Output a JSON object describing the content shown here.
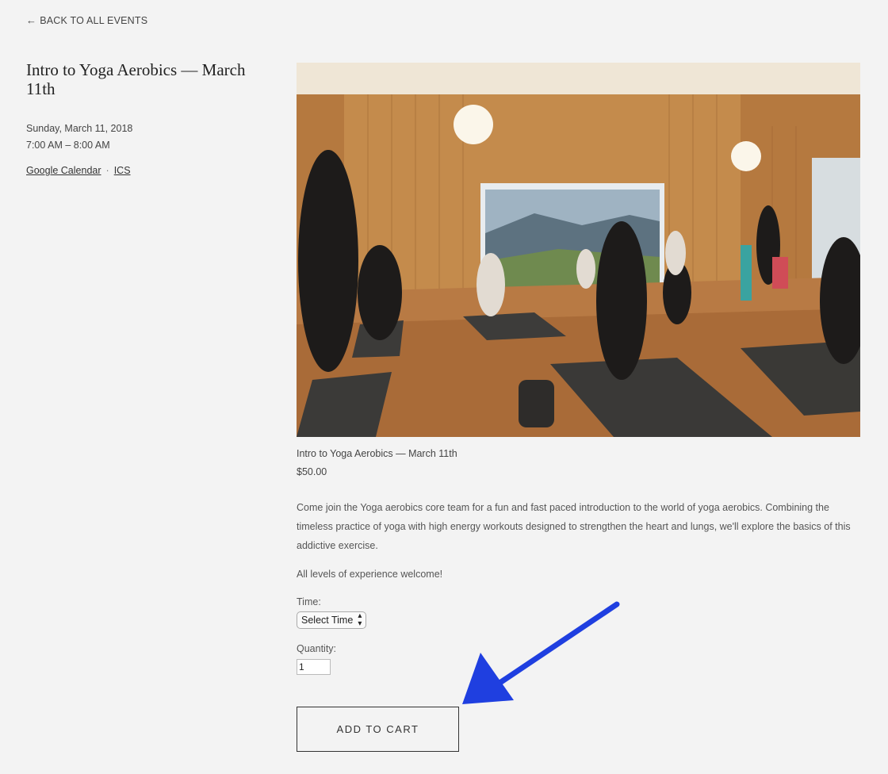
{
  "nav": {
    "back_label": "BACK TO ALL EVENTS",
    "back_icon": "left-arrow-icon"
  },
  "event": {
    "title": "Intro to Yoga Aerobics — March 11th",
    "date": "Sunday, March 11, 2018",
    "time": "7:00 AM – 8:00 AM",
    "google_calendar": "Google Calendar",
    "separator": "·",
    "ics": "ICS"
  },
  "product": {
    "name": "Intro to Yoga Aerobics — March 11th",
    "price": "$50.00",
    "description": "Come join the Yoga aerobics core team for a fun and fast paced introduction to the world of yoga aerobics. Combining the timeless practice of yoga with high energy workouts designed to strengthen the heart and lungs, we'll explore the basics of this addictive exercise.",
    "levels": "All levels of experience welcome!",
    "time_label": "Time:",
    "time_select": "Select Time",
    "quantity_label": "Quantity:",
    "quantity_value": "1",
    "add_to_cart": "ADD TO CART"
  },
  "colors": {
    "annotation_arrow": "#1f3fe0"
  }
}
